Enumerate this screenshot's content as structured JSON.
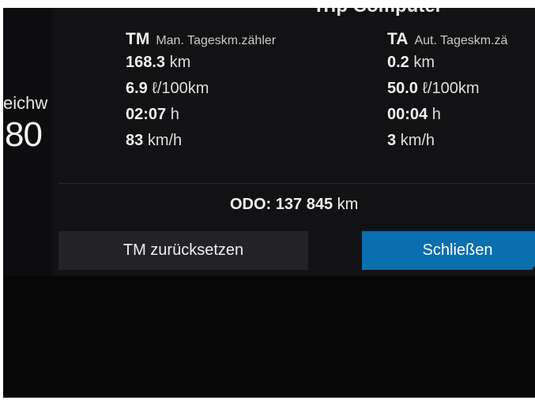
{
  "dialog_title": "Trip Computer",
  "background": {
    "label": "eichw",
    "value": "80"
  },
  "tm": {
    "abbr": "TM",
    "desc": "Man. Tageskm.zähler",
    "distance": {
      "value": "168.3",
      "unit": "km"
    },
    "consumption": {
      "value": "6.9",
      "unit": "ℓ/100km"
    },
    "time": {
      "value": "02:07",
      "unit": "h"
    },
    "speed": {
      "value": "83",
      "unit": "km/h"
    }
  },
  "ta": {
    "abbr": "TA",
    "desc": "Aut. Tageskm.zä",
    "distance": {
      "value": "0.2",
      "unit": "km"
    },
    "consumption": {
      "value": "50.0",
      "unit": "ℓ/100km"
    },
    "time": {
      "value": "00:04",
      "unit": "h"
    },
    "speed": {
      "value": "3",
      "unit": "km/h"
    }
  },
  "odo": {
    "label": "ODO:",
    "value": "137 845",
    "unit": "km"
  },
  "buttons": {
    "reset": "TM zurücksetzen",
    "close": "Schließen"
  },
  "colors": {
    "accent": "#0a6fae",
    "background": "#070708",
    "dialog": "#121214"
  }
}
